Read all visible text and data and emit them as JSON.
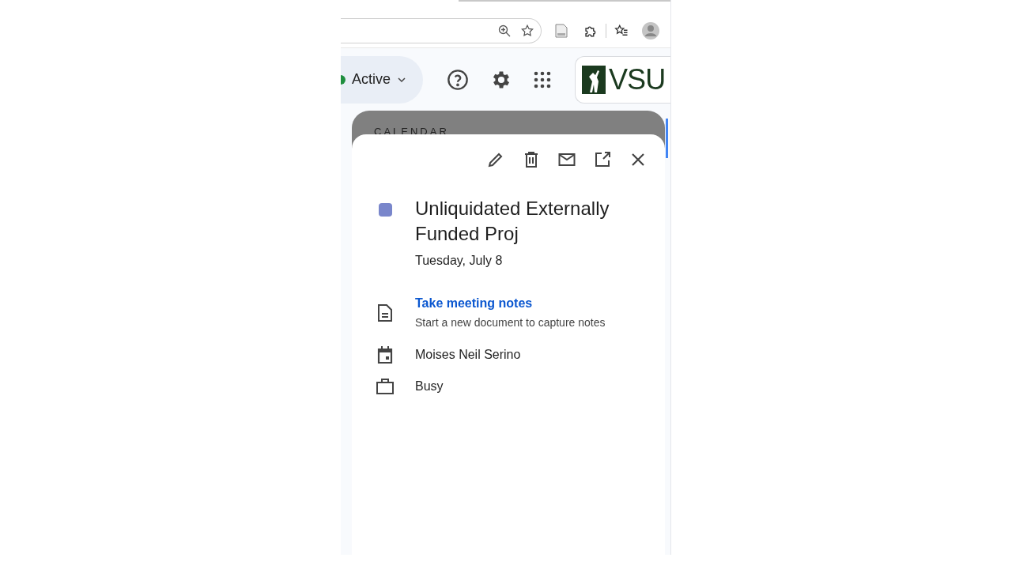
{
  "status": {
    "label": "Active",
    "color": "#1e8e3e"
  },
  "logo": {
    "text": "VSU"
  },
  "panel": {
    "label": "CALENDAR"
  },
  "event": {
    "title": "Unliquidated Externally Funded Proj",
    "date": "Tuesday, July 8",
    "color": "#7986cb"
  },
  "details": [
    {
      "kind": "notes",
      "link": "Take meeting notes",
      "text": "Start a new document to capture notes"
    },
    {
      "kind": "calendar",
      "text": "Moises Neil Serino"
    },
    {
      "kind": "availability",
      "text": "Busy"
    }
  ]
}
